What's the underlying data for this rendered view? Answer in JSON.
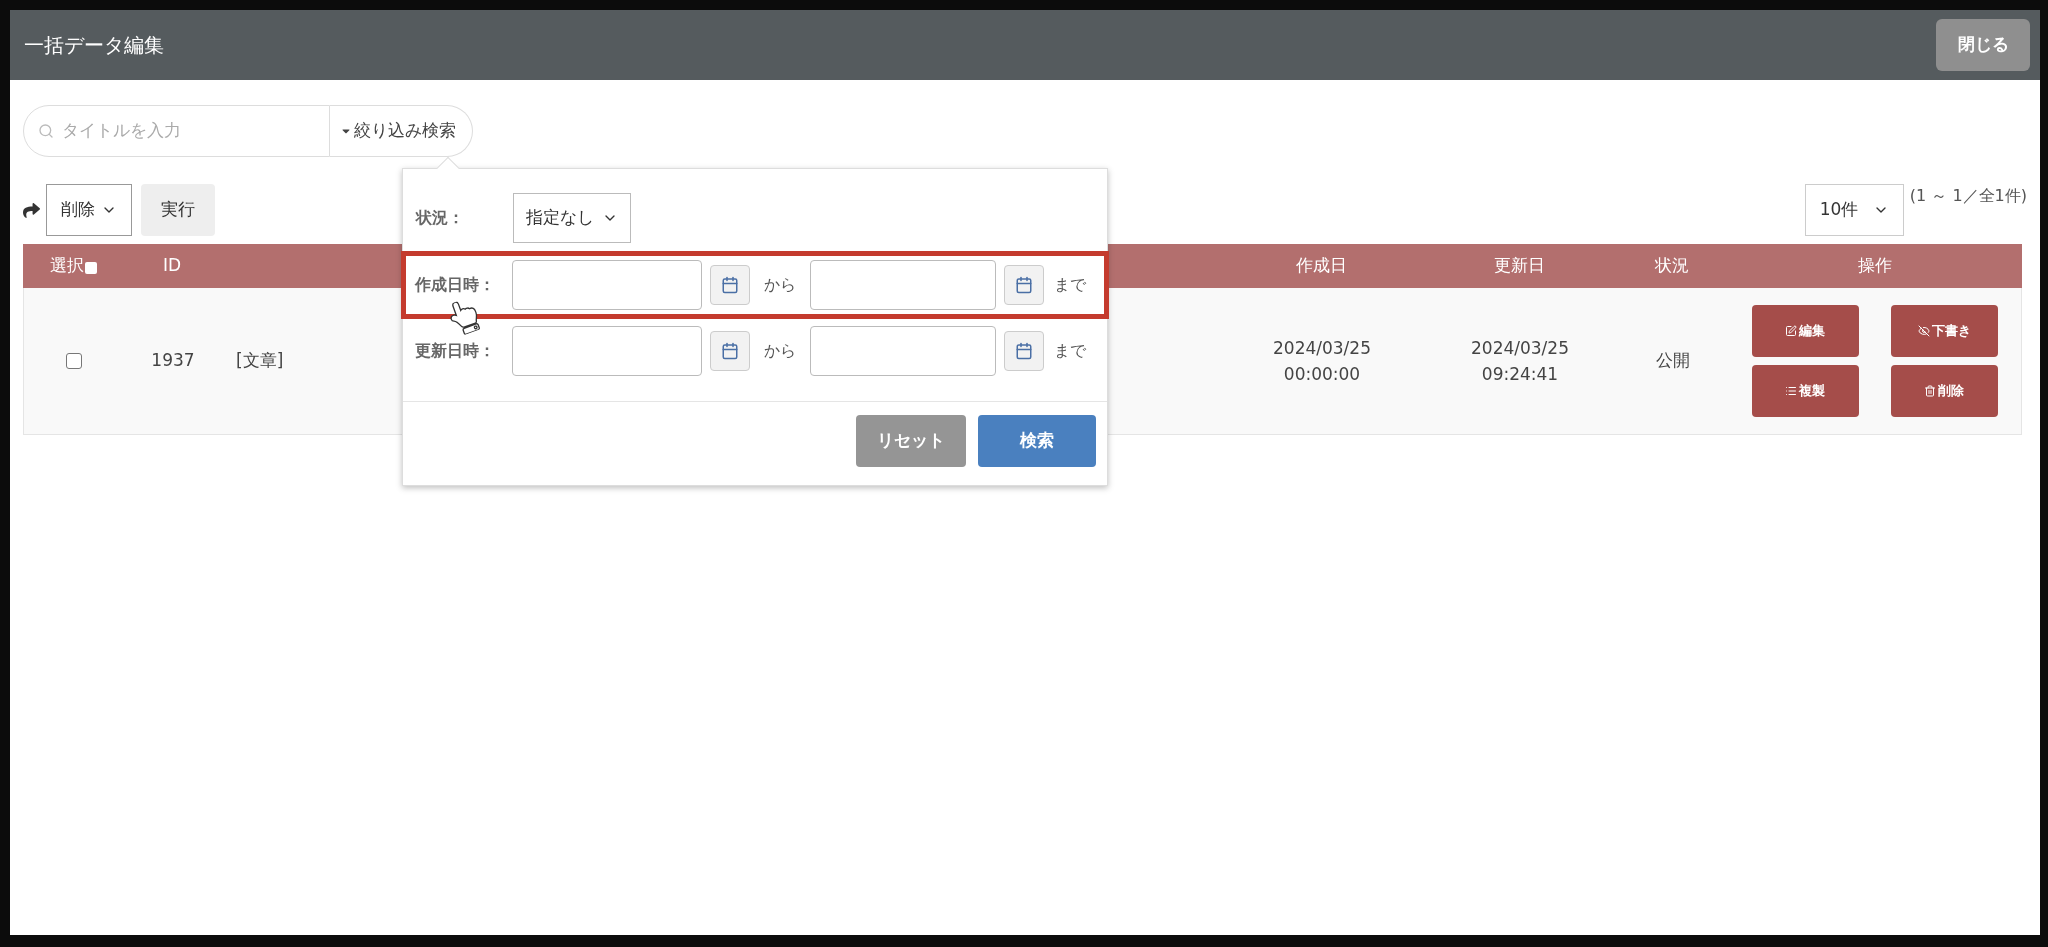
{
  "window": {
    "title": "一括データ編集",
    "close_button": "閉じる"
  },
  "search": {
    "placeholder": "タイトルを入力",
    "filter_button": "絞り込み検索"
  },
  "bulk": {
    "action": "削除",
    "run_button": "実行"
  },
  "pager": {
    "per_page": "10件",
    "summary": "(1 ～ 1／全1件)"
  },
  "table": {
    "select_all_checked": false,
    "columns": [
      {
        "label": "選択",
        "kind": "select"
      },
      {
        "label": "ID",
        "kind": "id"
      },
      {
        "kind": "title"
      },
      {
        "label": "作成日",
        "kind": "created"
      },
      {
        "label": "更新日",
        "kind": "updated"
      },
      {
        "label": "状況",
        "kind": "status"
      },
      {
        "label": "操作",
        "kind": "actions"
      }
    ],
    "rows": [
      {
        "checked": false,
        "id": "1937",
        "title": "[文章]",
        "created": [
          "2024/03/25",
          "00:00:00"
        ],
        "updated": [
          "2024/03/25",
          "09:24:41"
        ],
        "status": "公開",
        "actions": [
          {
            "kind": "edit",
            "label": "編集"
          },
          {
            "kind": "draft",
            "label": "下書き"
          },
          {
            "kind": "copy",
            "label": "複製"
          },
          {
            "kind": "delete",
            "label": "削除"
          }
        ]
      }
    ]
  },
  "filter_panel": {
    "status_label": "状況：",
    "status_value": "指定なし",
    "date_rows": [
      {
        "label": "作成日時：",
        "from": "から",
        "to": "まで",
        "highlighted": true
      },
      {
        "label": "更新日時：",
        "from": "から",
        "to": "まで",
        "highlighted": false
      }
    ],
    "reset_button": "リセット",
    "search_button": "検索"
  }
}
